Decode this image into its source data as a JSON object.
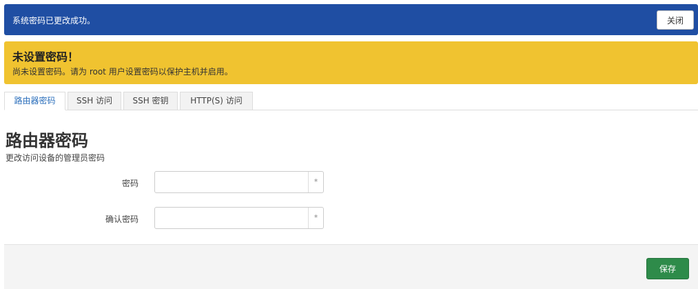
{
  "alert_info": {
    "message": "系统密码已更改成功。",
    "close_label": "关闭"
  },
  "alert_warning": {
    "title": "未设置密码！",
    "text": "尚未设置密码。请为 root 用户设置密码以保护主机并启用。"
  },
  "tabs": [
    {
      "label": "路由器密码",
      "active": true
    },
    {
      "label": "SSH 访问",
      "active": false
    },
    {
      "label": "SSH 密钥",
      "active": false
    },
    {
      "label": "HTTP(S) 访问",
      "active": false
    }
  ],
  "section": {
    "title": "路由器密码",
    "description": "更改访问设备的管理员密码"
  },
  "fields": {
    "password": {
      "label": "密码",
      "value": "",
      "addon": "*"
    },
    "confirm": {
      "label": "确认密码",
      "value": "",
      "addon": "*"
    }
  },
  "footer": {
    "save_label": "保存"
  },
  "colors": {
    "info_bg": "#1f4ea3",
    "warning_bg": "#f0c330",
    "active_tab_text": "#2a6ebb",
    "save_bg": "#2e8b4a"
  }
}
